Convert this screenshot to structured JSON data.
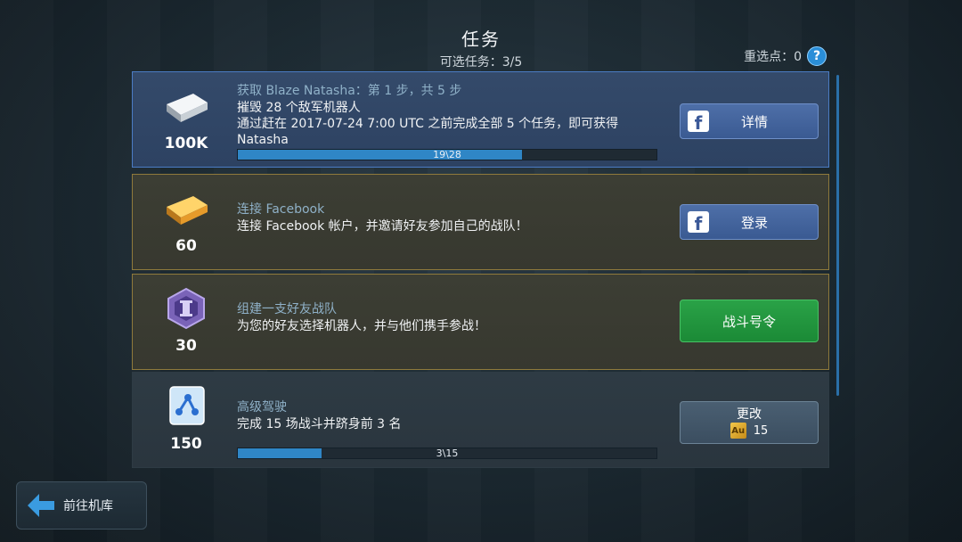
{
  "header": {
    "title": "任务",
    "subtitle": "可选任务：3/5"
  },
  "reroll": {
    "label": "重选点：0",
    "help": "?"
  },
  "missions": [
    {
      "reward_icon": "silver-bar-icon",
      "reward": "100K",
      "title": "获取 Blaze Natasha：第 1 步，共 5 步",
      "line1": "摧毁 28 个敌军机器人",
      "line2": "通过赶在 2017-07-24 7:00 UTC 之前完成全部 5 个任务，即可获得",
      "line3": "Natasha",
      "progress_text": "19\\28",
      "progress_fraction": 0.679,
      "button": {
        "label": "详情",
        "icon": "facebook-icon"
      }
    },
    {
      "reward_icon": "gold-bar-icon",
      "reward": "60",
      "title": "连接 Facebook",
      "line1": "连接 Facebook 帐户，并邀请好友参加自己的战队！",
      "button": {
        "label": "登录",
        "icon": "facebook-icon"
      }
    },
    {
      "reward_icon": "clan-hexagon-icon",
      "reward": "30",
      "title": "组建一支好友战队",
      "line1": "为您的好友选择机器人，并与他们携手参战！",
      "button": {
        "label": "战斗号令"
      }
    },
    {
      "reward_icon": "key-card-icon",
      "reward": "150",
      "title": "高级驾驶",
      "line1": "完成 15 场战斗并跻身前 3 名",
      "progress_text": "3\\15",
      "progress_fraction": 0.2,
      "button": {
        "label": "更改",
        "cost_icon": "Au",
        "cost": "15"
      }
    }
  ],
  "back_button": {
    "label": "前往机库",
    "icon": "arrow-left-icon"
  },
  "colors": {
    "accent_blue": "#2f86c6",
    "button_green": "#1b8a36",
    "facebook_blue": "#3a5a92"
  }
}
